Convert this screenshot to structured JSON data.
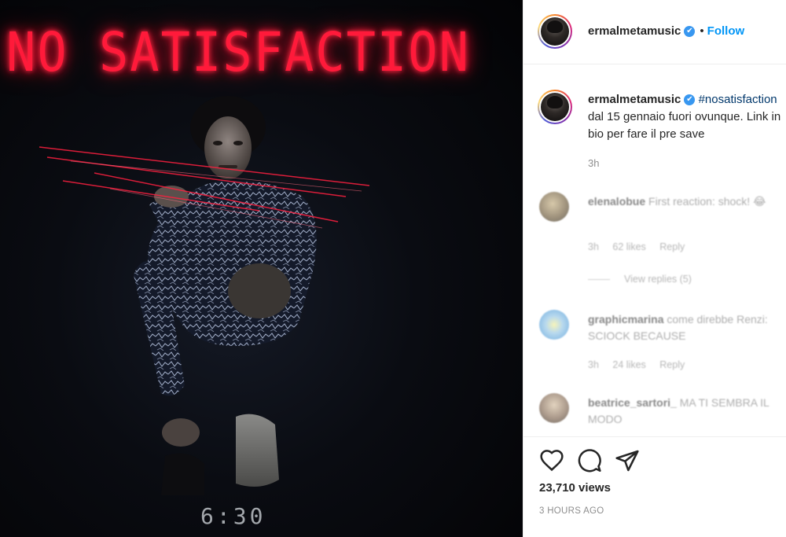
{
  "media": {
    "neon_title": "NO SATISFACTION",
    "counter_text": "6:30"
  },
  "header": {
    "username": "ermalmetamusic",
    "verified_mark": "✔",
    "separator": "•",
    "follow_label": "Follow"
  },
  "caption": {
    "username": "ermalmetamusic",
    "hashtag": "#nosatisfaction",
    "text": "dal 15 gennaio fuori ovunque. Link in bio per fare il pre save",
    "time": "3h"
  },
  "comments": [
    {
      "username": "elenalobue",
      "text": "First reaction: shock! 😂",
      "time": "3h",
      "likes": "62 likes",
      "reply_label": "Reply",
      "view_replies": "View replies (5)"
    },
    {
      "username": "graphicmarina",
      "text": "come direbbe Renzi: SCIOCK BECAUSE",
      "time": "3h",
      "likes": "24 likes",
      "reply_label": "Reply"
    },
    {
      "username": "beatrice_sartori_",
      "text": "MA TI SEMBRA IL MODO"
    }
  ],
  "actions": {
    "like_icon": "heart-icon",
    "comment_icon": "comment-icon",
    "share_icon": "share-icon",
    "views": "23,710 views",
    "time_ago": "3 HOURS AGO"
  },
  "colors": {
    "accent": "#0095f6",
    "verified": "#3897f0",
    "neon": "#ff1a3a",
    "media_bg": "#05060a"
  }
}
